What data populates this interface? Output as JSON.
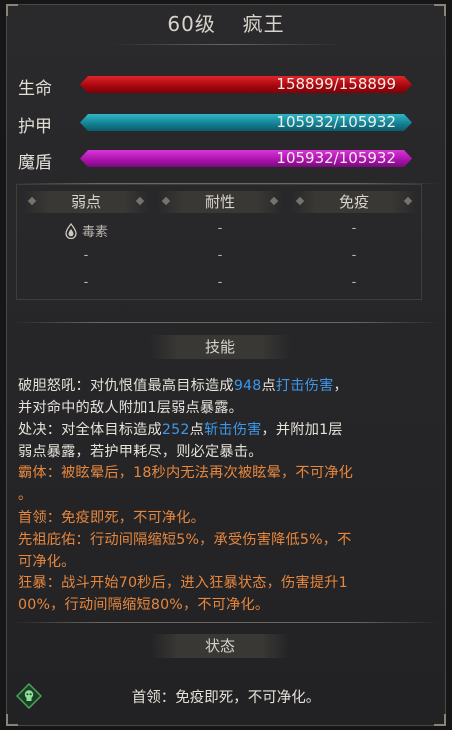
{
  "header": {
    "level_text": "60级",
    "name": "疯王"
  },
  "stats": [
    {
      "label": "生命",
      "value_text": "158899/158899",
      "fill_fraction": 1.0,
      "color": "#c4111a"
    },
    {
      "label": "护甲",
      "value_text": "105932/105932",
      "fill_fraction": 1.0,
      "color": "#1e9fb0"
    },
    {
      "label": "魔盾",
      "value_text": "105932/105932",
      "fill_fraction": 1.0,
      "color": "#c020c4"
    }
  ],
  "resistances": {
    "headers": [
      "弱点",
      "耐性",
      "免疫"
    ],
    "rows": [
      [
        "毒素",
        "-",
        "-"
      ],
      [
        "-",
        "-",
        "-"
      ],
      [
        "-",
        "-",
        "-"
      ]
    ],
    "weak_icon": "poison-drop-icon"
  },
  "skills_title": "技能",
  "skills": {
    "s1": {
      "a": "破胆怒吼：对仇恨值最高目标造成",
      "b": "948",
      "c": "点",
      "d": "打击伤害",
      "e": "，",
      "f": "并对命中的敌人附加1层弱点暴露。"
    },
    "s2": {
      "a": "处决：对全体目标造成",
      "b": "252",
      "c": "点",
      "d": "斩击伤害",
      "e": "，并附加1层",
      "f": "弱点暴露，若护甲耗尽，则必定暴击。"
    },
    "s3": "霸体：被眩晕后，18秒内无法再次被眩晕，不可净化",
    "s3b": "。",
    "s4": "首领：免疫即死，不可净化。",
    "s5a": "先祖庇佑：行动间隔缩短5%，承受伤害降低5%，不",
    "s5b": "可净化。",
    "s6a": "狂暴：战斗开始70秒后，进入狂暴状态，伤害提升1",
    "s6b": "00%，行动间隔缩短80%，不可净化。"
  },
  "status_title": "状态",
  "status": {
    "text": "首领：免疫即死，不可净化。",
    "icon": "skull-badge-icon"
  },
  "colors": {
    "orange_text": "#e7873e",
    "blue_text": "#3e97ea",
    "panel_bg": "#262628"
  }
}
